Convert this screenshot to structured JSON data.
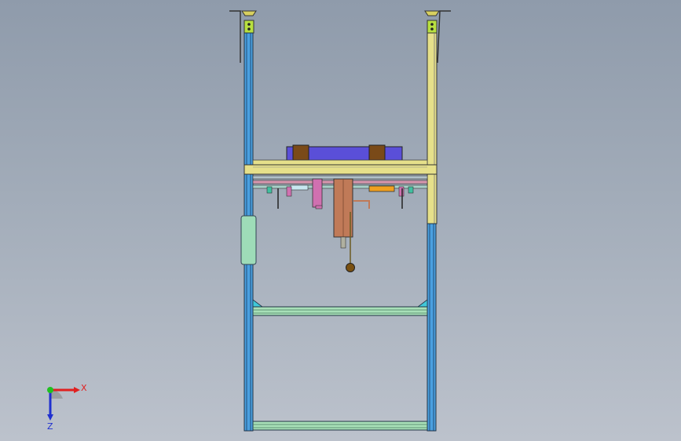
{
  "viewport": {
    "background_top": "#8f9bab",
    "background_bottom": "#bcc2cc"
  },
  "triad": {
    "x_label": "X",
    "z_label": "Z",
    "x_color": "#e02020",
    "y_color": "#20c020",
    "z_color": "#2030d0"
  },
  "colors": {
    "frame_blue": "#4aa0e0",
    "frame_yellow": "#e6e08a",
    "plate_purple": "#5a4fd8",
    "block_brown": "#7a4a18",
    "column_copper": "#c07a58",
    "rail_green": "#a8e0b8",
    "gusset_cyan": "#40c8d8",
    "orange_part": "#f0a020",
    "green_pad": "#9edcb8"
  }
}
